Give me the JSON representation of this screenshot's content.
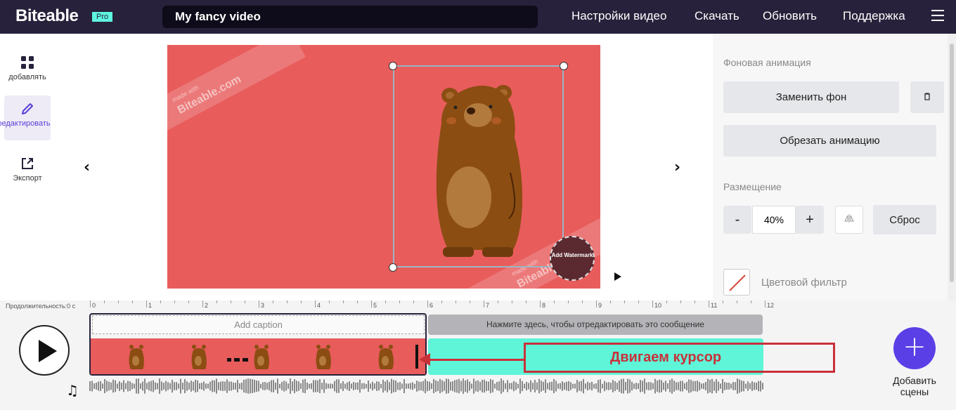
{
  "topbar": {
    "logo": "Biteable",
    "badge": "Pro",
    "video_title": "My fancy video",
    "nav": [
      "Настройки видео",
      "Скачать",
      "Обновить",
      "Поддержка"
    ],
    "menu_icon": "hamburger-icon"
  },
  "sidebar": {
    "items": [
      {
        "label": "добавлять",
        "icon": "grid-icon"
      },
      {
        "label": "редактировать",
        "icon": "pencil-icon"
      },
      {
        "label": "Экспорт",
        "icon": "export-icon"
      }
    ]
  },
  "stage": {
    "watermark_line1": "made with",
    "watermark_line2": "Biteable.com",
    "watermark_button": "Add Watermark",
    "background_color": "#e85c5c"
  },
  "panel": {
    "bg_anim_label": "Фоновая анимация",
    "replace_bg": "Заменить фон",
    "trim_anim": "Обрезать анимацию",
    "placement_label": "Размещение",
    "minus": "-",
    "scale_value": "40%",
    "plus": "+",
    "reset": "Сброс",
    "color_filter": "Цветовой фильтр"
  },
  "timeline": {
    "duration_label": "Продолжительность:0 с",
    "ticks": [
      "0",
      "1",
      "2",
      "3",
      "4",
      "5",
      "6",
      "7",
      "8",
      "9",
      "10",
      "11",
      "12"
    ],
    "add_caption": "Add caption",
    "scene2_caption": "Нажмите здесь, чтобы отредактировать это сообщение",
    "annotation": "Двигаем курсор",
    "add_scene_label": "Добавить сцены",
    "accent_color": "#5b3fe6",
    "scene2_color": "#5ef5d8",
    "annotation_color": "#c9303a"
  }
}
